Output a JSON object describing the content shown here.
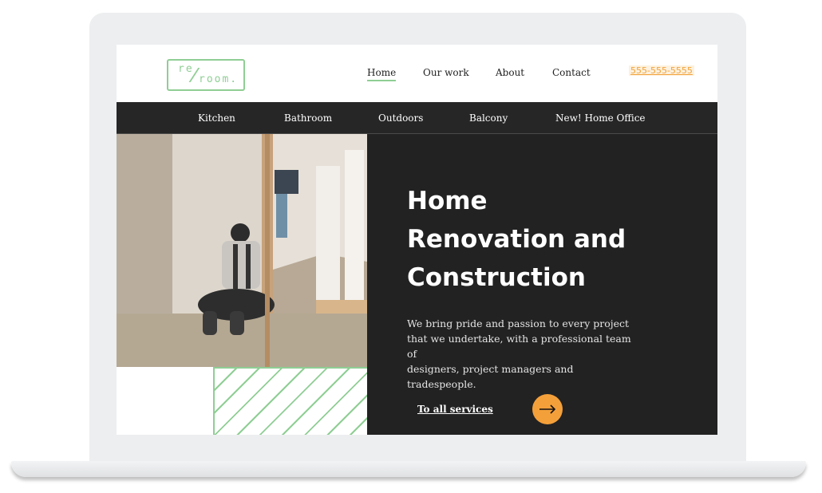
{
  "logo": {
    "line1": "re",
    "slash": "/",
    "line2": "room."
  },
  "nav": {
    "items": [
      {
        "label": "Home",
        "active": true
      },
      {
        "label": "Our work",
        "active": false
      },
      {
        "label": "About",
        "active": false
      },
      {
        "label": "Contact",
        "active": false
      }
    ],
    "phone": "555-555-5555"
  },
  "categories": [
    "Kitchen",
    "Bathroom",
    "Outdoors",
    "Balcony",
    "New! Home Office"
  ],
  "hero": {
    "title_lines": [
      "Home",
      "Renovation and",
      "Construction"
    ],
    "description_lines": [
      "We bring pride and passion to every project",
      "that we undertake, with a professional team of",
      "designers, project managers and tradespeople."
    ],
    "cta_label": "To all services",
    "cta_icon": "arrow-right-icon",
    "photo_subject": "worker-kneeling-in-unfinished-room"
  },
  "colors": {
    "accent_green": "#8fce94",
    "accent_orange": "#f4a03a",
    "dark": "#222222",
    "category_bar": "#262626"
  }
}
